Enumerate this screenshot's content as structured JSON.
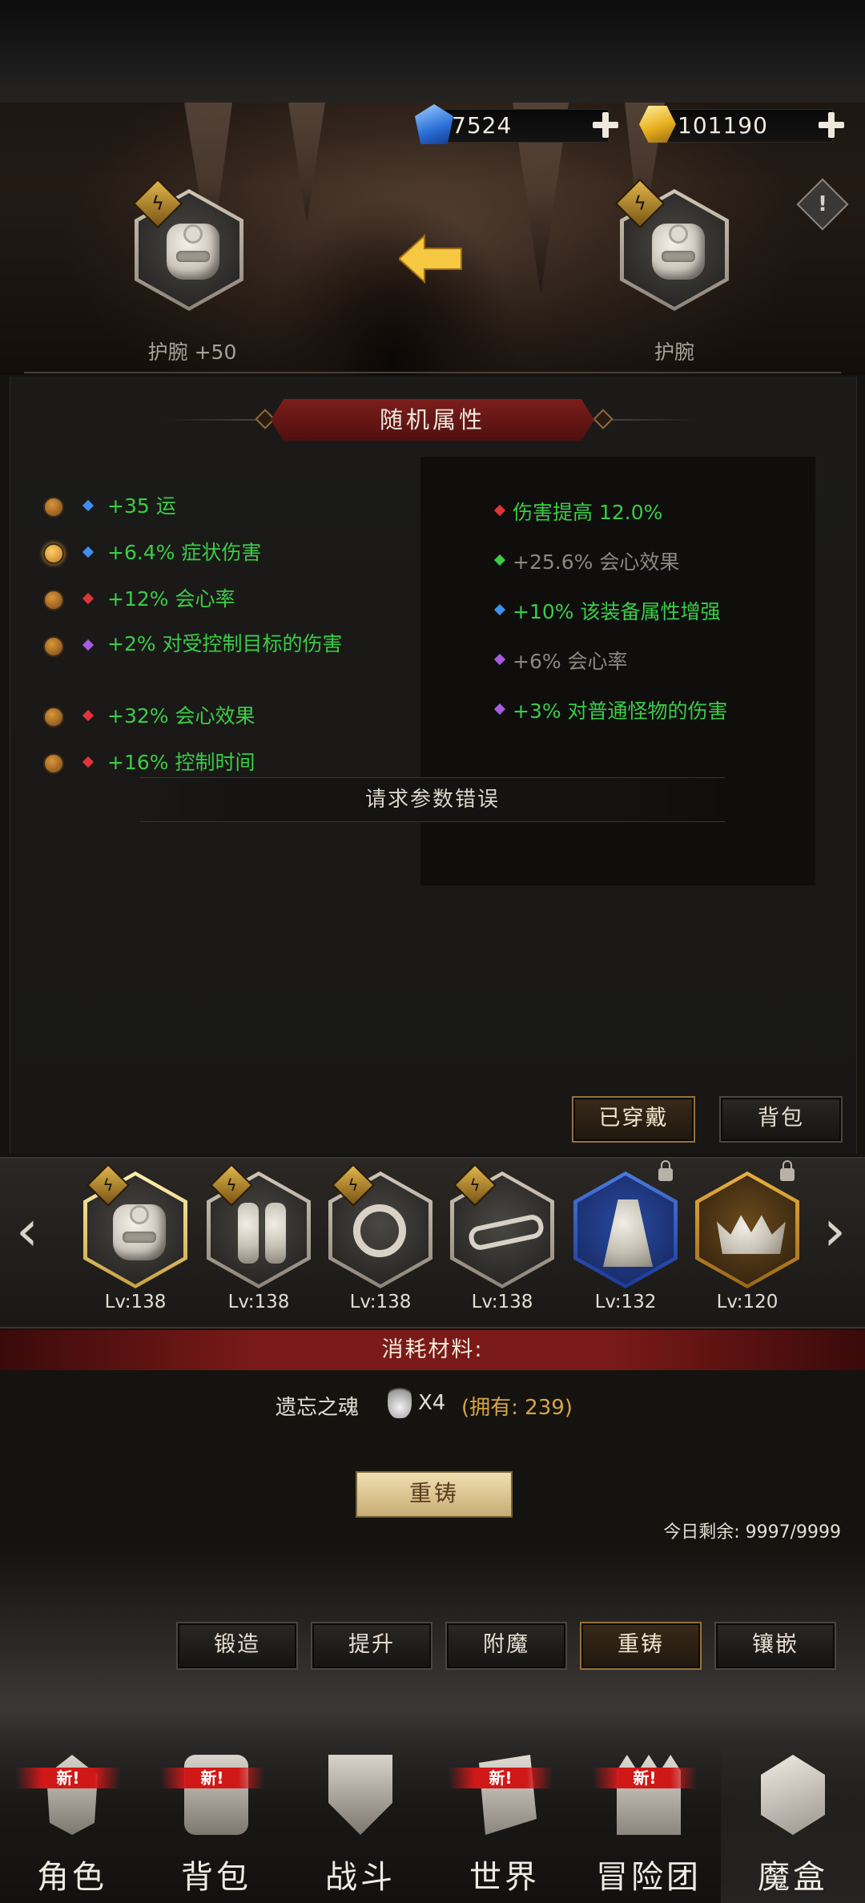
{
  "currency": {
    "gems": "7524",
    "gold": "101190"
  },
  "equip": {
    "current_label": "护腕 +50",
    "target_label": "护腕"
  },
  "section_title": "随机属性",
  "left_attributes": [
    {
      "gem": "blue",
      "text": "+35 运"
    },
    {
      "gem": "blue",
      "text": "+6.4% 症状伤害"
    },
    {
      "gem": "red",
      "text": "+12% 会心率"
    },
    {
      "gem": "purple",
      "text": "+2% 对受控制目标的伤害"
    },
    {
      "gem": "red",
      "text": "+32% 会心效果"
    },
    {
      "gem": "red",
      "text": "+16% 控制时间"
    }
  ],
  "right_attributes": [
    {
      "gem": "red",
      "text": "伤害提高 12.0%",
      "dim": false
    },
    {
      "gem": "green",
      "text": "+25.6% 会心效果",
      "dim": true
    },
    {
      "gem": "blue",
      "text": "+10% 该装备属性增强",
      "dim": false
    },
    {
      "gem": "purple",
      "text": "+6% 会心率",
      "dim": true
    },
    {
      "gem": "purple",
      "text": "+3% 对普通怪物的伤害",
      "dim": false
    }
  ],
  "error_message": "请求参数错误",
  "panel_buttons": {
    "equipped": "已穿戴",
    "bag": "背包"
  },
  "slots": [
    {
      "level": "Lv:138"
    },
    {
      "level": "Lv:138"
    },
    {
      "level": "Lv:138"
    },
    {
      "level": "Lv:138"
    },
    {
      "level": "Lv:132"
    },
    {
      "level": "Lv:120"
    }
  ],
  "materials": {
    "header": "消耗材料:",
    "name": "遗忘之魂",
    "count": "X4",
    "owned": "(拥有: 239)"
  },
  "reforge_button": "重铸",
  "daily_remaining": "今日剩余: 9997/9999",
  "tabs": [
    "锻造",
    "提升",
    "附魔",
    "重铸",
    "镶嵌"
  ],
  "active_tab": "重铸",
  "nav": [
    "角色",
    "背包",
    "战斗",
    "世界",
    "冒险团",
    "魔盒"
  ],
  "new_badge": "新!",
  "colors": {
    "attr_green": "#3bcc47",
    "banner_red": "#7c1e1c",
    "gold_accent": "#e0b64c"
  }
}
